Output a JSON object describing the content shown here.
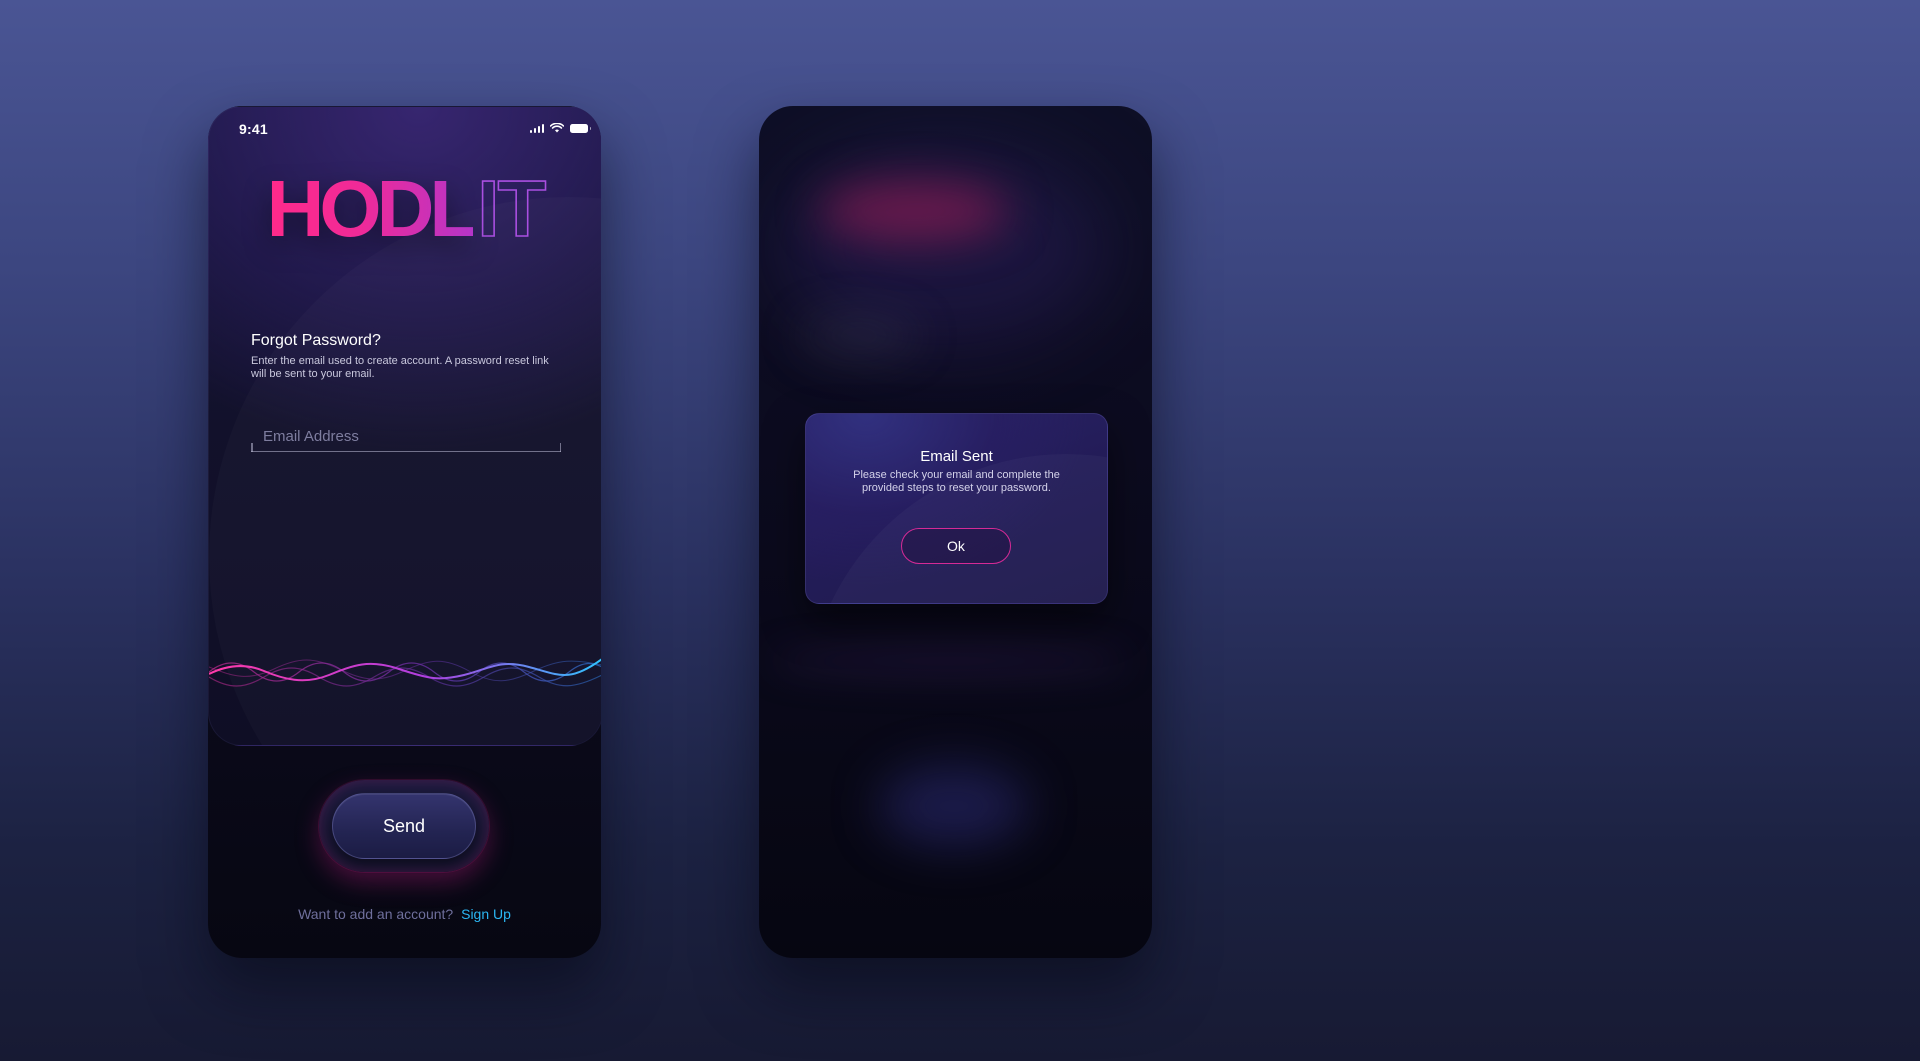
{
  "theme": {
    "accent_pink": "#ff2a8a",
    "accent_purple": "#a94fe0",
    "link_blue": "#2bb6f2",
    "background": "#3c4680"
  },
  "forgot_screen": {
    "status_time": "9:41",
    "status_icons": [
      "signal-icon",
      "wifi-icon",
      "battery-icon"
    ],
    "logo": {
      "solid": "HODL",
      "outline": "IT"
    },
    "title": "Forgot Password?",
    "description": "Enter the email used to create account. A password reset link will be sent to your email.",
    "email_input": {
      "placeholder": "Email Address",
      "value": ""
    },
    "send_label": "Send",
    "signup_prompt": "Want to add an account?",
    "signup_link": "Sign Up"
  },
  "email_sent_screen": {
    "dialog": {
      "title": "Email Sent",
      "message": "Please check your email and complete the provided steps to reset your password.",
      "ok_label": "Ok"
    }
  }
}
